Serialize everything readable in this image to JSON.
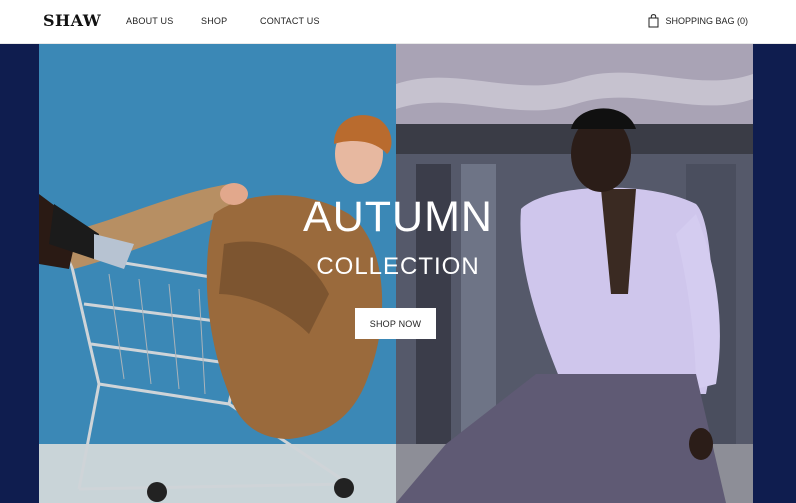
{
  "header": {
    "brand": "SHAW",
    "nav": [
      {
        "label": "ABOUT US"
      },
      {
        "label": "SHOP"
      },
      {
        "label": "CONTACT US"
      }
    ],
    "bag_label": "SHOPPING BAG (0)",
    "bag_icon": "shopping-bag-icon"
  },
  "hero": {
    "headline_line1": "AUTUMN",
    "headline_line2": "COLLECTION",
    "cta_label": "SHOP NOW",
    "colors": {
      "frame": "#0f1d4f",
      "left_backdrop": "#3b88b6",
      "right_backdrop": "#7a7f8c",
      "text": "#ffffff"
    },
    "images": {
      "left": "model-in-shopping-cart-photo",
      "right": "model-in-lavender-shirt-photo"
    }
  }
}
